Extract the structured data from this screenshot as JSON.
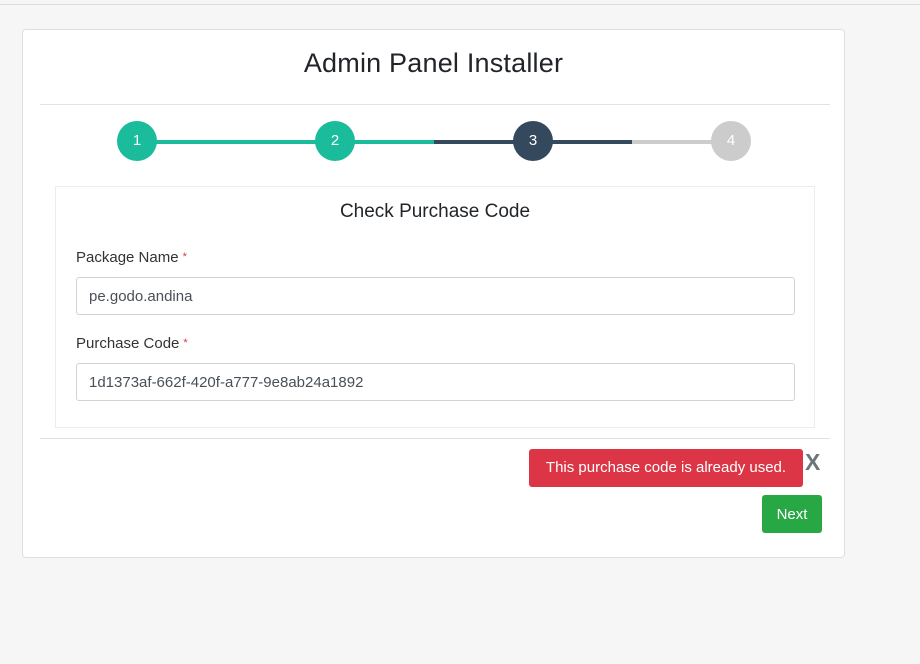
{
  "page": {
    "title": "Admin Panel Installer"
  },
  "stepper": {
    "steps": [
      {
        "label": "1",
        "state": "done",
        "color": "#1abc9c"
      },
      {
        "label": "2",
        "state": "done",
        "color": "#1abc9c"
      },
      {
        "label": "3",
        "state": "active",
        "color": "#34495e"
      },
      {
        "label": "4",
        "state": "pending",
        "color": "#cccccc"
      }
    ]
  },
  "form": {
    "title": "Check Purchase Code",
    "package_name": {
      "label": "Package Name",
      "required_mark": "*",
      "value": "pe.godo.andina"
    },
    "purchase_code": {
      "label": "Purchase Code",
      "required_mark": "*",
      "value": "1d1373af-662f-420f-a777-9e8ab24a1892"
    }
  },
  "alert": {
    "message": "This purchase code is already used.",
    "close_label": "X",
    "color": "#dc3545"
  },
  "actions": {
    "next_label": "Next",
    "next_color": "#28a745"
  }
}
